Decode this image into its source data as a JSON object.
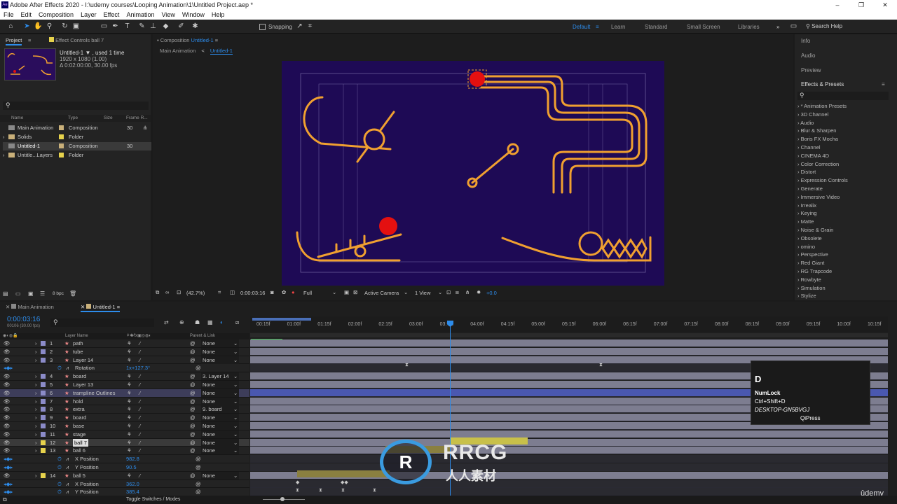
{
  "window": {
    "title": "Adobe After Effects 2020 - I:\\udemy courses\\Looping Animation\\1\\Untitled Project.aep *",
    "app_icon": "Ae",
    "min": "–",
    "max": "❐",
    "close": "✕"
  },
  "menu": [
    "File",
    "Edit",
    "Composition",
    "Layer",
    "Effect",
    "Animation",
    "View",
    "Window",
    "Help"
  ],
  "toolbar": {
    "snapping": "Snapping",
    "workspaces": [
      "Default",
      "Learn",
      "Standard",
      "Small Screen",
      "Libraries"
    ],
    "active_workspace": "Default",
    "search_help": "Search Help",
    "more": "»"
  },
  "project": {
    "tab": "Project",
    "effect_controls": "Effect Controls ball 7",
    "selected_name": "Untitled-1 ▼ , used 1 time",
    "res": "1920 x 1080 (1.00)",
    "dur": "Δ 0:02:00:00, 30.00 fps",
    "search_icon": "⚲",
    "columns": {
      "name": "Name",
      "type": "Type",
      "size": "Size",
      "frame": "Frame R..."
    },
    "items": [
      {
        "name": "Main Animation",
        "type": "Composition",
        "fps": "30"
      },
      {
        "name": "Solids",
        "type": "Folder",
        "fps": ""
      },
      {
        "name": "Untitled-1",
        "type": "Composition",
        "fps": "30"
      },
      {
        "name": "Untitle...Layers",
        "type": "Folder",
        "fps": ""
      }
    ],
    "bpc": "8 bpc"
  },
  "comp": {
    "tab_prefix": "Composition",
    "tab_name": "Untitled-1",
    "crumb1": "Main Animation",
    "crumb_sep": "<",
    "crumb2": "Untitled-1",
    "zoom": "(42.7%)",
    "time": "0:00:03:16",
    "quality": "Full",
    "camera": "Active Camera",
    "views": "1 View",
    "exposure": "+0.0"
  },
  "right": {
    "info": "Info",
    "audio": "Audio",
    "preview": "Preview",
    "effects": "Effects & Presets",
    "search_icon": "⚲",
    "effects_list": [
      "* Animation Presets",
      "3D Channel",
      "Audio",
      "Blur & Sharpen",
      "Boris FX Mocha",
      "Channel",
      "CINEMA 4D",
      "Color Correction",
      "Distort",
      "Expression Controls",
      "Generate",
      "Immersive Video",
      "Irrealix",
      "Keying",
      "Matte",
      "Noise & Grain",
      "Obsolete",
      "omino",
      "Perspective",
      "Red Giant",
      "RG Trapcode",
      "Rowbyte",
      "Simulation",
      "Stylize"
    ]
  },
  "timeline": {
    "tab1": "Main Animation",
    "tab2": "Untitled-1",
    "timecode": "0:00:03:16",
    "frames": "00106 (30.00 fps)",
    "search_icon": "⚲",
    "col_name": "Layer Name",
    "col_parent": "Parent & Link",
    "toggle": "Toggle Switches / Modes",
    "ruler": [
      "00:15f",
      "01:00f",
      "01:15f",
      "02:00f",
      "02:15f",
      "03:00f",
      "03:??f",
      "04:00f",
      "04:15f",
      "05:00f",
      "05:15f",
      "06:00f",
      "06:15f",
      "07:00f",
      "07:15f",
      "08:00f",
      "08:15f",
      "09:00f",
      "09:15f",
      "10:00f",
      "10:15f"
    ],
    "layers": [
      {
        "num": "1",
        "name": "path",
        "parent": "None"
      },
      {
        "num": "2",
        "name": "tube",
        "parent": "None"
      },
      {
        "num": "3",
        "name": "Layer 14",
        "parent": "None"
      },
      {
        "num": "",
        "name": "Rotation",
        "parent": "",
        "value": "1x+127.3°"
      },
      {
        "num": "4",
        "name": "board",
        "parent": "3. Layer 14"
      },
      {
        "num": "5",
        "name": "Layer 13",
        "parent": "None"
      },
      {
        "num": "6",
        "name": "trampline Outlines",
        "parent": "None"
      },
      {
        "num": "7",
        "name": "hold",
        "parent": "None"
      },
      {
        "num": "8",
        "name": "extra",
        "parent": "9. board"
      },
      {
        "num": "9",
        "name": "board",
        "parent": "None"
      },
      {
        "num": "10",
        "name": "base",
        "parent": "None"
      },
      {
        "num": "11",
        "name": "stage",
        "parent": "None"
      },
      {
        "num": "12",
        "name": "ball 7",
        "parent": "None"
      },
      {
        "num": "13",
        "name": "ball 6",
        "parent": "None"
      },
      {
        "num": "",
        "name": "X Position",
        "parent": "",
        "value": "982.8"
      },
      {
        "num": "",
        "name": "Y Position",
        "parent": "",
        "value": "90.5"
      },
      {
        "num": "14",
        "name": "ball 5",
        "parent": "None"
      },
      {
        "num": "",
        "name": "X Position",
        "parent": "",
        "value": "362.0"
      },
      {
        "num": "",
        "name": "Y Position",
        "parent": "",
        "value": "385.4"
      }
    ]
  },
  "osd": {
    "key": "D",
    "numlock": "NumLock",
    "shortcut": "Ctrl+Shift+D",
    "machine": "DESKTOP-GN5BVGJ",
    "app": "QiPress"
  },
  "watermark": {
    "text": "RRCG",
    "sub": "人人素材",
    "udemy": "ûdemy"
  },
  "colors": {
    "accent": "#2d8ceb",
    "comp_bg": "#1e0a55",
    "line": "#f0a030",
    "ball": "#e41010",
    "track": "#7d7d90",
    "track_sel": "#4a58b0",
    "key_bar": "#c8c04a"
  }
}
